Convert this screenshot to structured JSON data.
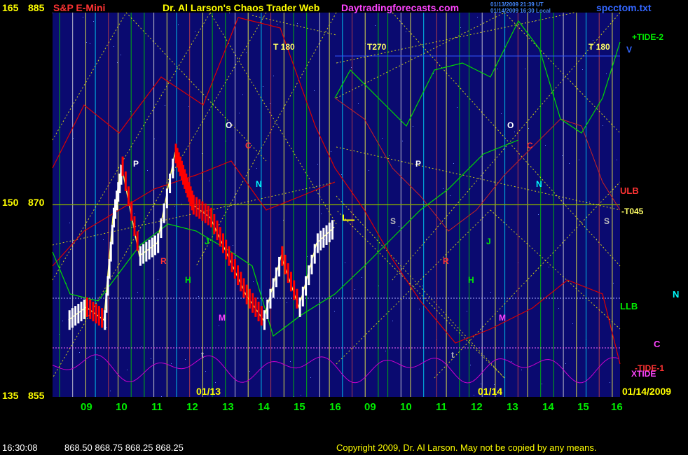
{
  "header": {
    "symbol": "S&P E-Mini",
    "title": "Dr. Al Larson's Chaos Trader Web",
    "site": "Daytradingforecasts.com",
    "ts1": "01/13/2009 21:39 UT",
    "ts2": "01/14/2009 16:30 Local",
    "file": "spcctom.txt"
  },
  "footer": {
    "time": "16:30:08",
    "quote": "868.50 868.75 868.25 868.25",
    "copyright": "Copyright 2009, Dr. Al Larson. May not be copied by any means."
  },
  "colors": {
    "background": "#000000",
    "plot_background": "#0a0a70",
    "price_up": "#ffffff",
    "price_down": "#ff0000",
    "tide2": "#00dd00",
    "xtide": "#cc00cc",
    "envelope": "#dd0000",
    "grid_yellow": "#ffff00",
    "axis_text": "#ffff00"
  },
  "chart_data": {
    "type": "line",
    "title": "S&P E-Mini",
    "ylabel": "",
    "xlabel": "",
    "ylim": [
      855,
      885
    ],
    "y_ticks": [
      {
        "left": "165",
        "value": 885,
        "label": "885"
      },
      {
        "left": "150",
        "value": 870,
        "label": "870"
      },
      {
        "left": "135",
        "value": 855,
        "label": "855"
      }
    ],
    "x_hours": [
      "09",
      "10",
      "11",
      "12",
      "13",
      "14",
      "15",
      "16",
      "09",
      "10",
      "11",
      "12",
      "13",
      "14",
      "15",
      "16"
    ],
    "date_labels": [
      "01/13",
      "01/14",
      "01/14/2009"
    ],
    "series": [
      {
        "name": "Price (01/13)",
        "x": [
          8.5,
          9.0,
          9.5,
          9.75,
          10.0,
          10.5,
          11.0,
          11.5,
          11.75,
          12.0,
          12.5,
          13.0,
          13.5,
          14.0,
          14.5,
          15.0,
          15.5,
          16.0
        ],
        "y": [
          861,
          862,
          861,
          869,
          873,
          866,
          867,
          874,
          872,
          870,
          869,
          866,
          863,
          861,
          866,
          862,
          867,
          868.25
        ]
      },
      {
        "name": "Flag L",
        "x": [
          16.3
        ],
        "y": [
          868.8
        ]
      }
    ],
    "labels": {
      "right": [
        "+TIDE-2",
        "V",
        "ULB",
        "-T045",
        "LLB",
        "N",
        "C",
        "-TIDE-1",
        "XTIDE"
      ],
      "turns": [
        "T 180",
        "T270",
        "T 180"
      ],
      "letters": [
        "P",
        "O",
        "C",
        "N",
        "R",
        "H",
        "J",
        "M",
        "S",
        "t",
        "L"
      ]
    }
  }
}
